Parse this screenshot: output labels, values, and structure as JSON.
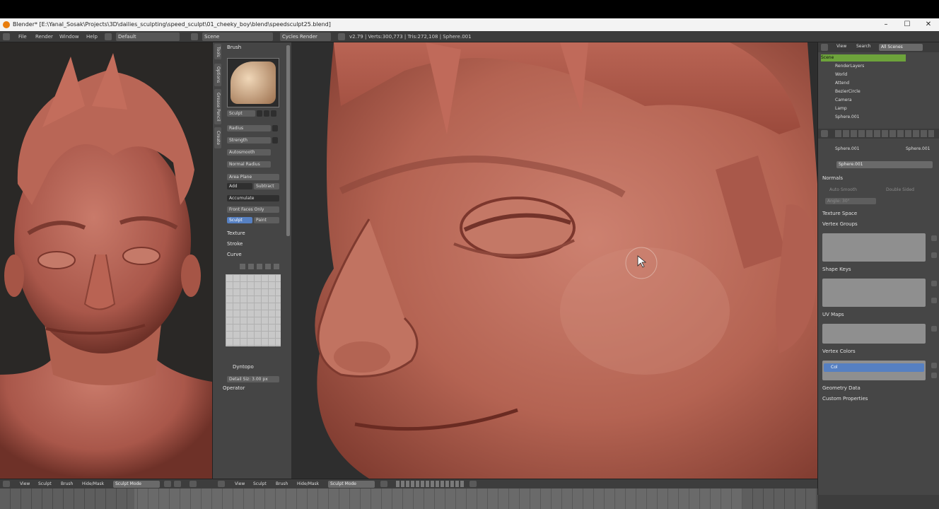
{
  "window": {
    "title": "Blender* [E:\\Yanal_Sosak\\Projects\\3D\\dailies_sculpting\\speed_sculpt\\01_cheeky_boy\\blend\\speedsculpt25.blend]",
    "minimize": "–",
    "maximize": "☐",
    "close": "✕"
  },
  "infobar": {
    "menus": [
      "File",
      "Render",
      "Window",
      "Help"
    ],
    "layout": "Default",
    "scene": "Scene",
    "engine": "Cycles Render",
    "stats": "v2.79 | Verts:300,773 | Tris:272,108 | Sphere.001"
  },
  "toolshelf": {
    "tabs": [
      "Tools",
      "Options",
      "Grease Pencil",
      "Create"
    ],
    "brush_header": "Brush",
    "brush_name": "Sculpt",
    "fields": [
      "Radius",
      "Strength",
      "Autosmooth",
      "Normal Radius",
      "Area Plane",
      "Add",
      "Subtract",
      "Front Faces Only"
    ],
    "accumulate": "Accumulate",
    "btn_sculpt": "Sculpt",
    "btn_paint": "Paint",
    "sections": [
      "Texture",
      "Stroke",
      "Curve"
    ],
    "dyntopo": "Dyntopo",
    "detail_size": "Detail Siz: 3.00 px",
    "operator": "Operator"
  },
  "outliner": {
    "menus": [
      "View",
      "Search",
      "All Scenes"
    ],
    "rows": [
      "Scene",
      "RenderLayers",
      "World",
      "Attend",
      "BezierCircle",
      "Camera",
      "Lamp",
      "Sphere.001"
    ]
  },
  "properties": {
    "breadcrumb_obj": "Sphere.001",
    "breadcrumb_mesh": "Sphere.001",
    "mesh_name": "Sphere.001",
    "normals": "Normals",
    "auto_smooth": "Auto Smooth",
    "double_sided": "Double Sided",
    "angle": "Angle: 30°",
    "sections": [
      "Texture Space",
      "Vertex Groups",
      "Shape Keys",
      "UV Maps",
      "Vertex Colors",
      "Geometry Data",
      "Custom Properties"
    ],
    "vertex_color_layer": "Col"
  },
  "bottombar": {
    "left": {
      "menus": [
        "View",
        "Sculpt",
        "Brush",
        "Hide/Mask"
      ],
      "mode": "Sculpt Mode"
    },
    "right": {
      "menus": [
        "View",
        "Sculpt",
        "Brush",
        "Hide/Mask"
      ],
      "mode": "Sculpt Mode"
    }
  },
  "colors": {
    "clay": "#b86a5c",
    "panel": "#454545",
    "accent": "#5680c2",
    "outliner_active": "#6da33b"
  }
}
